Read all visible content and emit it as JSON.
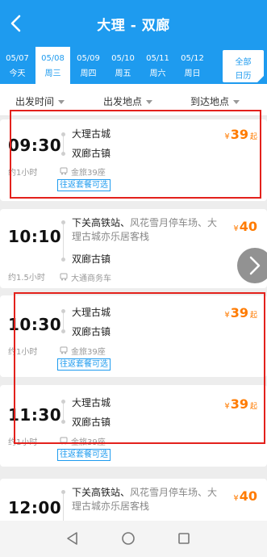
{
  "header": {
    "title": "大理 - 双廊"
  },
  "dates": [
    {
      "date": "05/07",
      "day": "今天",
      "active": false
    },
    {
      "date": "05/08",
      "day": "周三",
      "active": true
    },
    {
      "date": "05/09",
      "day": "周四",
      "active": false
    },
    {
      "date": "05/10",
      "day": "周五",
      "active": false
    },
    {
      "date": "05/11",
      "day": "周六",
      "active": false
    },
    {
      "date": "05/12",
      "day": "周日",
      "active": false
    }
  ],
  "calendar": {
    "line1": "全部",
    "line2": "日历"
  },
  "filters": {
    "depart_time": "出发时间",
    "depart_place": "出发地点",
    "arrive_place": "到达地点"
  },
  "trips": [
    {
      "time": "09:30",
      "duration": "约1小时",
      "from": "大理古城",
      "from_extra": "",
      "to": "双廊古镇",
      "bus": "金旅39座",
      "tag": "往返套餐可选",
      "price_symbol": "¥",
      "price": "39",
      "price_suffix": "起"
    },
    {
      "time": "10:10",
      "duration": "约1.5小时",
      "from": "下关高铁站、",
      "from_extra": "风花雪月停车场、大理古城亦乐居客栈",
      "to": "双廊古镇",
      "bus": "大通商务车",
      "tag": "",
      "price_symbol": "¥",
      "price": "40",
      "price_suffix": ""
    },
    {
      "time": "10:30",
      "duration": "约1小时",
      "from": "大理古城",
      "from_extra": "",
      "to": "双廊古镇",
      "bus": "金旅39座",
      "tag": "往返套餐可选",
      "price_symbol": "¥",
      "price": "39",
      "price_suffix": "起"
    },
    {
      "time": "11:30",
      "duration": "约1小时",
      "from": "大理古城",
      "from_extra": "",
      "to": "双廊古镇",
      "bus": "金旅39座",
      "tag": "往返套餐可选",
      "price_symbol": "¥",
      "price": "39",
      "price_suffix": "起"
    },
    {
      "time": "12:00",
      "duration": "",
      "from": "下关高铁站、",
      "from_extra": "风花雪月停车场、大理古城亦乐居客栈",
      "to": "",
      "bus": "",
      "tag": "",
      "price_symbol": "¥",
      "price": "40",
      "price_suffix": ""
    }
  ],
  "colors": {
    "primary": "#1e9bef",
    "price": "#ff7b00",
    "highlight_box": "#e3211c"
  },
  "icons": {
    "back": "chevron-left-icon",
    "next": "chevron-right-icon",
    "bus": "bus-icon",
    "nav_back": "triangle-back-icon",
    "nav_home": "circle-home-icon",
    "nav_recent": "square-recent-icon"
  }
}
